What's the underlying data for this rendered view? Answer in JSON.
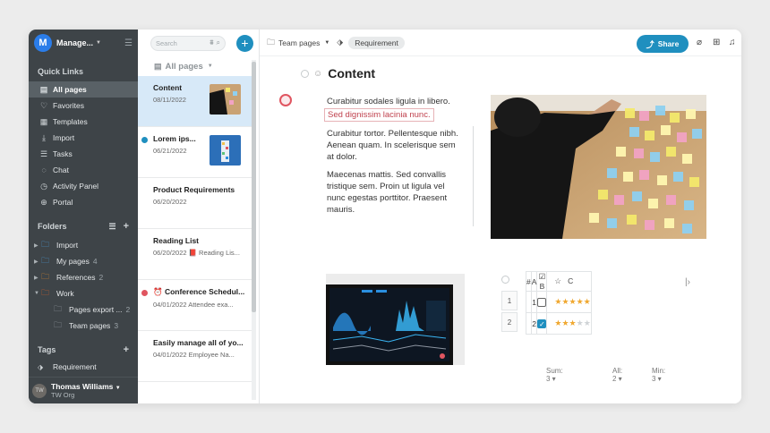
{
  "workspace": {
    "initial": "M",
    "name": "Manage..."
  },
  "quick_links": {
    "title": "Quick Links",
    "items": [
      {
        "label": "All pages",
        "icon": "file-icon",
        "glyph": "▤",
        "active": true
      },
      {
        "label": "Favorites",
        "icon": "heart-icon",
        "glyph": "♡",
        "active": false
      },
      {
        "label": "Templates",
        "icon": "template-icon",
        "glyph": "▦",
        "active": false
      },
      {
        "label": "Import",
        "icon": "import-icon",
        "glyph": "⤓",
        "active": false
      },
      {
        "label": "Tasks",
        "icon": "tasks-icon",
        "glyph": "☰",
        "active": false
      },
      {
        "label": "Chat",
        "icon": "chat-icon",
        "glyph": "◌",
        "active": false
      },
      {
        "label": "Activity Panel",
        "icon": "activity-icon",
        "glyph": "◷",
        "active": false
      },
      {
        "label": "Portal",
        "icon": "portal-icon",
        "glyph": "⊕",
        "active": false
      }
    ]
  },
  "folders": {
    "title": "Folders",
    "items": [
      {
        "label": "Import",
        "count": "",
        "color": "#4a9fe0",
        "sub": false
      },
      {
        "label": "My pages",
        "count": "4",
        "color": "#4a9fe0",
        "sub": false
      },
      {
        "label": "References",
        "count": "2",
        "color": "#e08a2c",
        "sub": false
      },
      {
        "label": "Work",
        "count": "",
        "color": "#e0632c",
        "sub": false
      },
      {
        "label": "Pages export ...",
        "count": "2",
        "color": "#9aa2a7",
        "sub": true
      },
      {
        "label": "Team pages",
        "count": "3",
        "color": "#9aa2a7",
        "sub": true
      }
    ]
  },
  "tags": {
    "title": "Tags",
    "items": [
      {
        "label": "Requirement"
      }
    ]
  },
  "user": {
    "name": "Thomas Williams",
    "org": "TW Org",
    "initials": "TW"
  },
  "page_list": {
    "search_placeholder": "Search",
    "header": "All pages",
    "pages": [
      {
        "title": "Content",
        "meta": "08/11/2022",
        "selected": true,
        "dot": "",
        "thumb": "wall"
      },
      {
        "title": "Lorem ips...",
        "meta": "06/21/2022",
        "selected": false,
        "dot": "#1f8fbf",
        "thumb": "cubes"
      },
      {
        "title": "Product Requirements",
        "meta": "06/20/2022",
        "selected": false,
        "dot": "",
        "thumb": ""
      },
      {
        "title": "Reading List",
        "meta": "06/20/2022 📕 Reading Lis...",
        "selected": false,
        "dot": "",
        "thumb": ""
      },
      {
        "title": "⏰ Conference Schedul...",
        "meta": "04/01/2022 Attendee exa...",
        "selected": false,
        "dot": "#e05560",
        "thumb": ""
      },
      {
        "title": "Easily manage all of yo...",
        "meta": "04/01/2022 Employee Na...",
        "selected": false,
        "dot": "",
        "thumb": ""
      }
    ]
  },
  "breadcrumb": {
    "folder": "Team pages",
    "tag": "Requirement"
  },
  "toolbar": {
    "share": "Share"
  },
  "page": {
    "title": "Content",
    "para1": "Curabitur sodales ligula in libero.",
    "highlight": "Sed dignissim lacinia nunc.",
    "para2": "Curabitur tortor. Pellentesque nibh. Aenean quam. In scelerisque sem at dolor.",
    "para3": "Maecenas mattis. Sed convallis tristique sem. Proin ut ligula vel nunc egestas porttitor. Praesent mauris."
  },
  "table": {
    "headers": {
      "num": "#",
      "a": "A",
      "b": "B",
      "c": "C"
    },
    "rows": [
      {
        "n": "1",
        "a": "1",
        "b": false,
        "stars": 5
      },
      {
        "n": "2",
        "a": "2",
        "b": true,
        "stars": 3
      }
    ],
    "footer": {
      "sum": "Sum: 3",
      "all": "All: 2",
      "min": "Min: 3"
    }
  }
}
